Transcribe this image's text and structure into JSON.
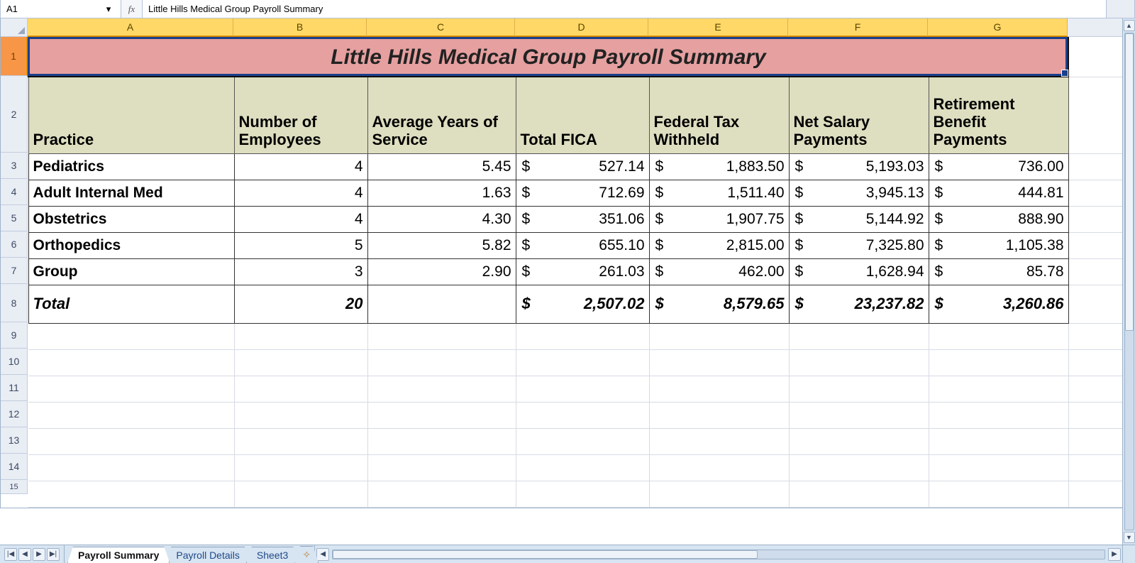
{
  "namebox": "A1",
  "fx_label": "fx",
  "formula_value": "Little Hills Medical Group Payroll Summary",
  "columns": [
    "A",
    "B",
    "C",
    "D",
    "E",
    "F",
    "G"
  ],
  "rows_visible": [
    "1",
    "2",
    "3",
    "4",
    "5",
    "6",
    "7",
    "8",
    "9",
    "10",
    "11",
    "12",
    "13",
    "14",
    "15"
  ],
  "title": "Little Hills Medical Group Payroll Summary",
  "headers": {
    "practice": "Practice",
    "num_employees": "Number of Employees",
    "avg_years": "Average Years of Service",
    "total_fica": "Total FICA",
    "fed_tax": "Federal Tax Withheld",
    "net_salary": "Net Salary Payments",
    "retirement": "Retirement Benefit Payments"
  },
  "rows": [
    {
      "practice": "Pediatrics",
      "num": "4",
      "avg": "5.45",
      "fica": "527.14",
      "fed": "1,883.50",
      "net": "5,193.03",
      "ret": "736.00"
    },
    {
      "practice": "Adult Internal Med",
      "num": "4",
      "avg": "1.63",
      "fica": "712.69",
      "fed": "1,511.40",
      "net": "3,945.13",
      "ret": "444.81"
    },
    {
      "practice": "Obstetrics",
      "num": "4",
      "avg": "4.30",
      "fica": "351.06",
      "fed": "1,907.75",
      "net": "5,144.92",
      "ret": "888.90"
    },
    {
      "practice": "Orthopedics",
      "num": "5",
      "avg": "5.82",
      "fica": "655.10",
      "fed": "2,815.00",
      "net": "7,325.80",
      "ret": "1,105.38"
    },
    {
      "practice": "Group",
      "num": "3",
      "avg": "2.90",
      "fica": "261.03",
      "fed": "462.00",
      "net": "1,628.94",
      "ret": "85.78"
    }
  ],
  "total": {
    "label": "Total",
    "num": "20",
    "avg": "",
    "fica": "2,507.02",
    "fed": "8,579.65",
    "net": "23,237.82",
    "ret": "3,260.86"
  },
  "currency_symbol": "$",
  "tabs": [
    {
      "label": "Payroll Summary",
      "active": true
    },
    {
      "label": "Payroll Details",
      "active": false
    },
    {
      "label": "Sheet3",
      "active": false
    }
  ],
  "tab_nav": {
    "first": "|◀",
    "prev": "◀",
    "next": "▶",
    "last": "▶|"
  },
  "scroll": {
    "left": "◀",
    "right": "▶",
    "up": "▲",
    "down": "▼"
  }
}
